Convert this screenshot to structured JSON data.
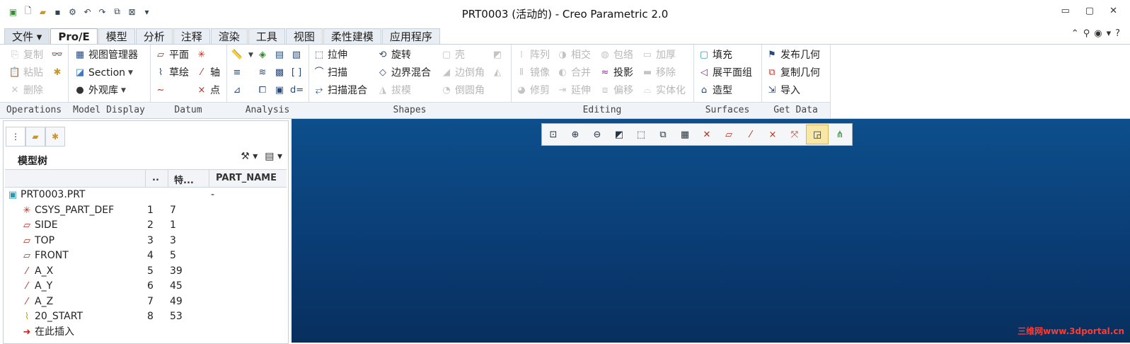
{
  "window": {
    "title": "PRT0003 (活动的) - Creo Parametric 2.0",
    "controls": [
      "▭",
      "▢",
      "✕"
    ]
  },
  "quick_access": [
    "app-icon",
    "new-icon",
    "open-icon",
    "save-icon",
    "regenerate-icon",
    "undo-icon",
    "redo-icon",
    "window-icon",
    "close-window-icon",
    "customize-icon"
  ],
  "tabs": [
    "文件",
    "Pro/E",
    "模型",
    "分析",
    "注释",
    "渲染",
    "工具",
    "视图",
    "柔性建模",
    "应用程序"
  ],
  "active_tab": "Pro/E",
  "ribbon": {
    "operations": {
      "label": "Operations",
      "copy": "复制",
      "paste": "粘贴",
      "delete": "删除"
    },
    "model_display": {
      "label": "Model Display",
      "view_manager": "视图管理器",
      "section": "Section",
      "appearance": "外观库"
    },
    "datum": {
      "label": "Datum",
      "plane": "平面",
      "sketch": "草绘",
      "axis": "轴",
      "point": "点"
    },
    "analysis": {
      "label": "Analysis"
    },
    "shapes": {
      "label": "Shapes",
      "extrude": "拉伸",
      "revolve": "旋转",
      "shell": "壳",
      "sweep": "扫描",
      "blend": "边界混合",
      "edge_chamfer": "边倒角",
      "swept_blend": "扫描混合",
      "draft": "拔模",
      "round": "倒圆角"
    },
    "editing": {
      "label": "Editing",
      "pattern": "阵列",
      "intersect": "相交",
      "wrap": "包络",
      "thicken": "加厚",
      "mirror": "镜像",
      "merge": "合并",
      "project": "投影",
      "remove": "移除",
      "trim": "修剪",
      "extend": "延伸",
      "offset": "偏移",
      "solidify": "实体化"
    },
    "surfaces": {
      "label": "Surfaces",
      "fill": "填充",
      "flatten": "展平面组",
      "style": "造型"
    },
    "get_data": {
      "label": "Get Data",
      "publish_geom": "发布几何",
      "copy_geom": "复制几何",
      "import": "导入"
    }
  },
  "model_tree": {
    "title": "模型树",
    "columns": [
      "..",
      "特...",
      "PART_NAME"
    ],
    "rows": [
      {
        "icon": "part-icon",
        "name": "PRT0003.PRT",
        "c1": "",
        "c2": "",
        "c3": "-"
      },
      {
        "icon": "csys-icon",
        "name": "CSYS_PART_DEF",
        "c1": "1",
        "c2": "7",
        "c3": ""
      },
      {
        "icon": "plane-icon",
        "name": "SIDE",
        "c1": "2",
        "c2": "1",
        "c3": ""
      },
      {
        "icon": "plane-icon",
        "name": "TOP",
        "c1": "3",
        "c2": "3",
        "c3": ""
      },
      {
        "icon": "plane-icon",
        "name": "FRONT",
        "c1": "4",
        "c2": "5",
        "c3": ""
      },
      {
        "icon": "axis-icon",
        "name": "A_X",
        "c1": "5",
        "c2": "39",
        "c3": ""
      },
      {
        "icon": "axis-icon",
        "name": "A_Y",
        "c1": "6",
        "c2": "45",
        "c3": ""
      },
      {
        "icon": "axis-icon",
        "name": "A_Z",
        "c1": "7",
        "c2": "49",
        "c3": ""
      },
      {
        "icon": "sketch-icon",
        "name": "20_START",
        "c1": "8",
        "c2": "53",
        "c3": ""
      },
      {
        "icon": "insert-arrow-icon",
        "name": "在此插入",
        "c1": "",
        "c2": "",
        "c3": ""
      }
    ]
  },
  "graphics_toolbar": [
    "refit-icon",
    "zoom-in-icon",
    "zoom-out-icon",
    "repaint-icon",
    "display-style-icon",
    "saved-views-icon",
    "view-manager-icon",
    "plane-display-icon",
    "axis-display-icon",
    "point-display-icon",
    "csys-display-icon",
    "spin-center-icon",
    "annotation-display-icon"
  ],
  "watermark": "三维网www.3dportal.cn"
}
